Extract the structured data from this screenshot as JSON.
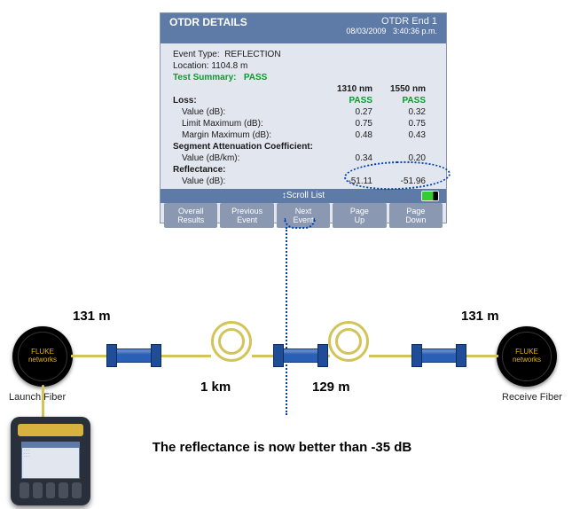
{
  "otdr": {
    "title": "OTDR DETAILS",
    "sub": "OTDR End 1",
    "stamp_date": "08/03/2009",
    "stamp_time": "3:40:36 p.m.",
    "event_type_label": "Event Type:",
    "event_type": "REFLECTION",
    "location_label": "Location:",
    "location": "1104.8 m",
    "summary_label": "Test Summary:",
    "summary": "PASS",
    "wl1": "1310 nm",
    "wl2": "1550 nm",
    "loss_label": "Loss:",
    "loss_r1": "PASS",
    "loss_r2": "PASS",
    "val_db_label": "Value (dB):",
    "val_db_1": "0.27",
    "val_db_2": "0.32",
    "lim_label": "Limit Maximum (dB):",
    "lim_1": "0.75",
    "lim_2": "0.75",
    "mar_label": "Margin Maximum (dB):",
    "mar_1": "0.48",
    "mar_2": "0.43",
    "seg_label": "Segment Attenuation Coefficient:",
    "seg_val_label": "Value (dB/km):",
    "seg_1": "0.34",
    "seg_2": "0.20",
    "ref_label": "Reflectance:",
    "ref_val_label": "Value (dB):",
    "ref_1": "-51.11",
    "ref_2": "-51.96",
    "scroll": "↕Scroll List",
    "tabs": {
      "t1a": "Overall",
      "t1b": "Results",
      "t2a": "Previous",
      "t2b": "Event",
      "t3a": "Next",
      "t3b": "Event",
      "t4a": "Page",
      "t4b": "Up",
      "t5a": "Page",
      "t5b": "Down"
    }
  },
  "diagram": {
    "brand1": "FLUKE",
    "brand2": "networks",
    "launch_label": "Launch Fiber",
    "receive_label": "Receive Fiber",
    "d131": "131 m",
    "d1km": "1 km",
    "d129": "129 m",
    "note": "The reflectance is now better than -35 dB"
  }
}
